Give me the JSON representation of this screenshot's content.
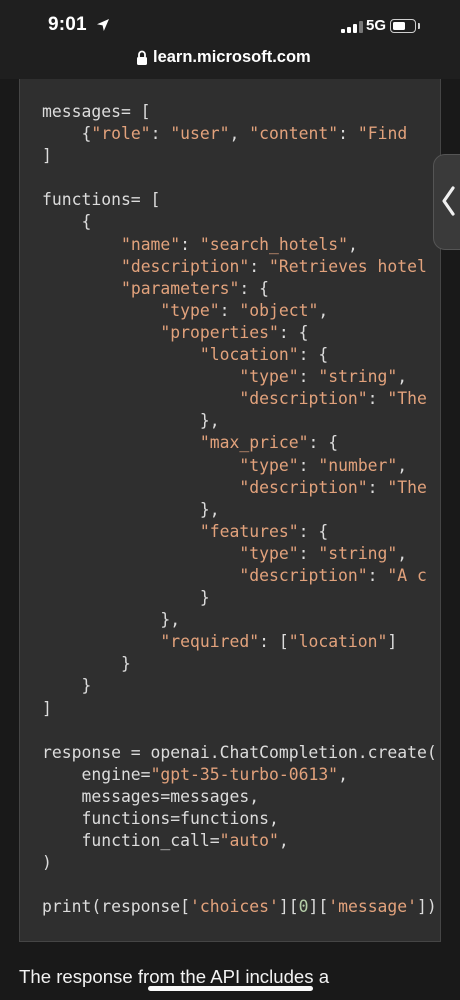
{
  "status_bar": {
    "time": "9:01",
    "network": "5G",
    "icons": [
      "location-arrow-icon",
      "signal-bars-icon",
      "battery-icon"
    ],
    "battery_level": 0.6
  },
  "browser": {
    "url": "learn.microsoft.com",
    "icons": [
      "lock-icon"
    ]
  },
  "side_tab": {
    "icon": "chevron-left-icon"
  },
  "colors": {
    "background": "#191919",
    "code_background": "#2f2f2f",
    "code_text": "#dcdcdc",
    "string": "#e2a27c",
    "number": "#b5cea8"
  },
  "code_lines": [
    "messages= [",
    "    {\"role\": \"user\", \"content\": \"Find",
    "]",
    "",
    "functions= [",
    "    {",
    "        \"name\": \"search_hotels\",",
    "        \"description\": \"Retrieves hotel",
    "        \"parameters\": {",
    "            \"type\": \"object\",",
    "            \"properties\": {",
    "                \"location\": {",
    "                    \"type\": \"string\",",
    "                    \"description\": \"The",
    "                },",
    "                \"max_price\": {",
    "                    \"type\": \"number\",",
    "                    \"description\": \"The",
    "                },",
    "                \"features\": {",
    "                    \"type\": \"string\",",
    "                    \"description\": \"A c",
    "                }",
    "            },",
    "            \"required\": [\"location\"]",
    "        }",
    "    }",
    "]",
    "",
    "response = openai.ChatCompletion.create(",
    "    engine=\"gpt-35-turbo-0613\",",
    "    messages=messages,",
    "    functions=functions,",
    "    function_call=\"auto\",",
    ")",
    "",
    "print(response['choices'][0]['message'])"
  ],
  "paragraph": "The response from the API includes a"
}
